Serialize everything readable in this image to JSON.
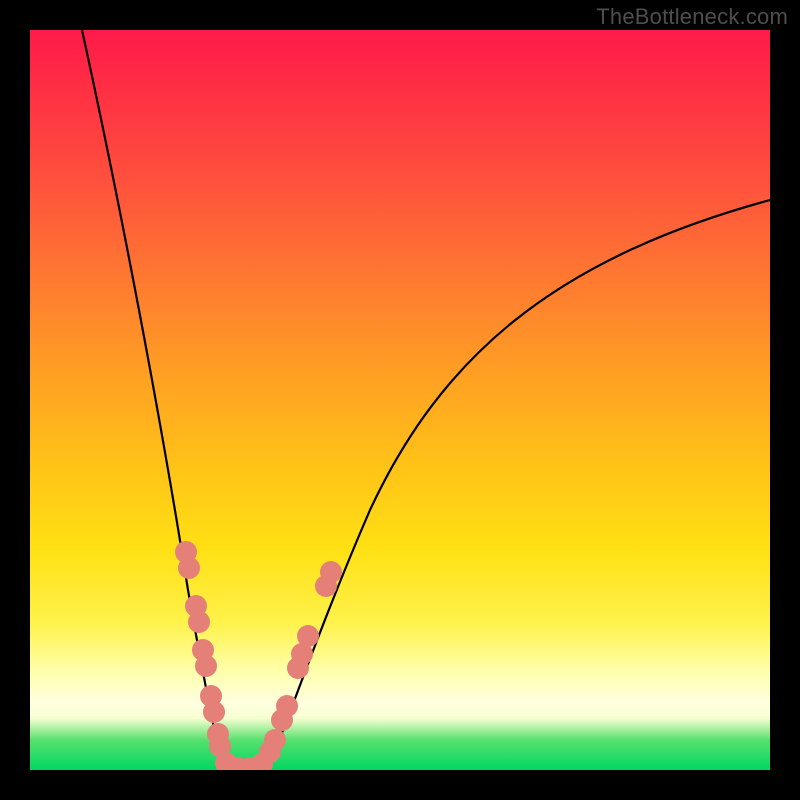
{
  "watermark": {
    "text": "TheBottleneck.com"
  },
  "colors": {
    "frame": "#000000",
    "curve": "#000000",
    "beads": "#e58078",
    "gradient_stops": [
      "#ff1a4a",
      "#ff553c",
      "#ff9e24",
      "#ffe014",
      "#ffffe0",
      "#56e06e",
      "#00d862"
    ]
  },
  "chart_data": {
    "type": "line",
    "title": "",
    "xlabel": "",
    "ylabel": "",
    "xlim": [
      0,
      100
    ],
    "ylim": [
      0,
      100
    ],
    "grid": false,
    "legend": null,
    "series": [
      {
        "name": "left-arm",
        "x": [
          7,
          10,
          12,
          14,
          16,
          18,
          20,
          22,
          23.5,
          25,
          26
        ],
        "y": [
          100,
          84,
          72,
          60,
          49,
          38,
          27,
          17,
          10,
          4,
          0
        ]
      },
      {
        "name": "valley-floor",
        "x": [
          26,
          28,
          30,
          32
        ],
        "y": [
          0,
          0,
          0,
          0
        ]
      },
      {
        "name": "right-arm",
        "x": [
          32,
          34,
          37,
          41,
          46,
          52,
          60,
          70,
          82,
          95,
          100
        ],
        "y": [
          0,
          6,
          14,
          24,
          35,
          45,
          55,
          63,
          70,
          75,
          77
        ]
      }
    ],
    "annotations": [
      {
        "name": "beads-left-arm",
        "points": [
          {
            "x": 21.0,
            "y": 30
          },
          {
            "x": 21.2,
            "y": 28
          },
          {
            "x": 22.4,
            "y": 22
          },
          {
            "x": 22.8,
            "y": 20
          },
          {
            "x": 23.4,
            "y": 16
          },
          {
            "x": 23.7,
            "y": 14
          },
          {
            "x": 24.4,
            "y": 10
          },
          {
            "x": 24.8,
            "y": 8
          },
          {
            "x": 25.3,
            "y": 5
          },
          {
            "x": 25.6,
            "y": 4
          }
        ]
      },
      {
        "name": "beads-valley",
        "points": [
          {
            "x": 26.5,
            "y": 0.5
          },
          {
            "x": 28.0,
            "y": 0
          },
          {
            "x": 29.5,
            "y": 0
          },
          {
            "x": 31.0,
            "y": 0.5
          }
        ]
      },
      {
        "name": "beads-right-arm",
        "points": [
          {
            "x": 32.2,
            "y": 2
          },
          {
            "x": 32.8,
            "y": 4
          },
          {
            "x": 33.6,
            "y": 7
          },
          {
            "x": 34.2,
            "y": 9
          },
          {
            "x": 35.8,
            "y": 14
          },
          {
            "x": 36.3,
            "y": 16
          },
          {
            "x": 37.0,
            "y": 18
          },
          {
            "x": 39.6,
            "y": 25
          },
          {
            "x": 40.2,
            "y": 27
          }
        ]
      }
    ]
  }
}
